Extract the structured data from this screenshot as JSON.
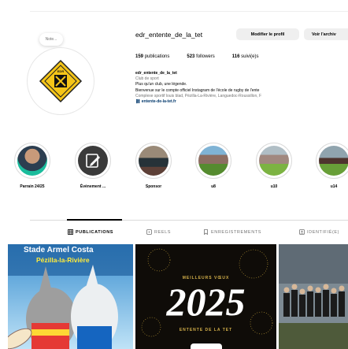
{
  "note": {
    "label": "Note..."
  },
  "profile": {
    "username": "edr_entente_de_la_tet",
    "edit_button": "Modifier le profil",
    "archive_button": "Voir l'archiv",
    "stats": {
      "publications_count": "159",
      "publications_label": "publications",
      "followers_count": "523",
      "followers_label": "followers",
      "following_count": "116",
      "following_label": "suivi(e)s"
    },
    "bio": {
      "name": "edr_entente_de_la_tet",
      "category": "Club de sport",
      "line1": "Plus qu'un club, une légende.",
      "line2": "Bienvenue sur le compte officiel Instagram de l'école de rugby de l'ente",
      "address": "Complexe sportif louis blad, Pézilla-La-Rivière, Languedoc-Roussillon, F",
      "link": "entente-de-la-tet.fr"
    },
    "logo_text": "ENTENTE DE LA TET"
  },
  "highlights": [
    {
      "label": "Parrain 24/25"
    },
    {
      "label": "Évènement ..."
    },
    {
      "label": "Sponsor"
    },
    {
      "label": "u8"
    },
    {
      "label": "u10"
    },
    {
      "label": "u14"
    }
  ],
  "tabs": [
    {
      "label": "PUBLICATIONS",
      "icon": "grid-icon"
    },
    {
      "label": "REELS",
      "icon": "reels-icon"
    },
    {
      "label": "ENREGISTREMENTS",
      "icon": "bookmark-icon"
    },
    {
      "label": "IDENTIFIÉ(E)",
      "icon": "tag-icon"
    }
  ],
  "posts": [
    {
      "caption_line1": "Stade Armel Costa",
      "caption_line2": "Pézilla-la-Rivière"
    },
    {
      "caption_top": "MEILLEURS VŒUX",
      "caption_main": "2025",
      "caption_bottom": "ENTENTE DE LA TET"
    },
    {
      "caption": ""
    }
  ],
  "colors": {
    "accent": "#f5c518",
    "link": "#00376b",
    "muted": "#737373",
    "button_bg": "#efefef"
  }
}
